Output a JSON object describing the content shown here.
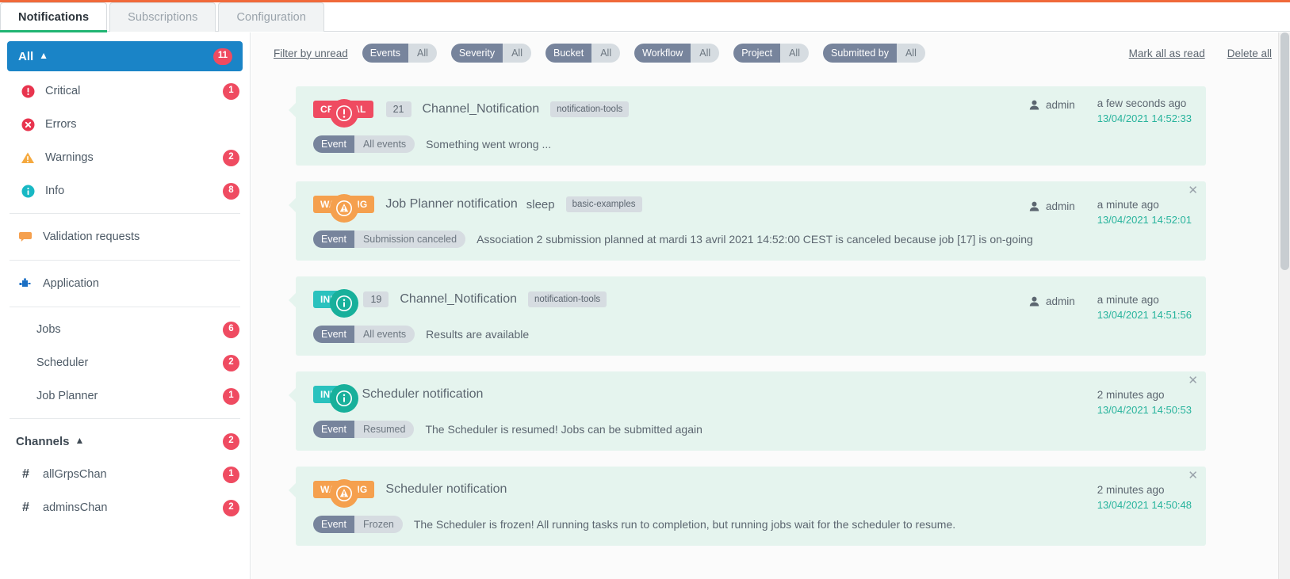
{
  "tabs": [
    {
      "label": "Notifications",
      "active": true
    },
    {
      "label": "Subscriptions",
      "active": false
    },
    {
      "label": "Configuration",
      "active": false
    }
  ],
  "sidebar": {
    "all": {
      "label": "All",
      "badge": "11"
    },
    "severities": [
      {
        "icon": "critical-icon",
        "label": "Critical",
        "badge": "1"
      },
      {
        "icon": "error-icon",
        "label": "Errors",
        "badge": ""
      },
      {
        "icon": "warning-icon",
        "label": "Warnings",
        "badge": "2"
      },
      {
        "icon": "info-icon",
        "label": "Info",
        "badge": "8"
      }
    ],
    "validation": {
      "icon": "comment-icon",
      "label": "Validation requests"
    },
    "application": {
      "icon": "puzzle-icon",
      "label": "Application"
    },
    "app_items": [
      {
        "label": "Jobs",
        "badge": "6"
      },
      {
        "label": "Scheduler",
        "badge": "2"
      },
      {
        "label": "Job Planner",
        "badge": "1"
      }
    ],
    "channels_header": {
      "label": "Channels",
      "badge": "2"
    },
    "channels": [
      {
        "hash": "#",
        "label": "allGrpsChan",
        "badge": "1"
      },
      {
        "hash": "#",
        "label": "adminsChan",
        "badge": "2"
      }
    ]
  },
  "filterbar": {
    "filter_by_unread": "Filter by unread",
    "filters": [
      {
        "key": "Events",
        "value": "All"
      },
      {
        "key": "Severity",
        "value": "All"
      },
      {
        "key": "Bucket",
        "value": "All"
      },
      {
        "key": "Workflow",
        "value": "All"
      },
      {
        "key": "Project",
        "value": "All"
      },
      {
        "key": "Submitted by",
        "value": "All"
      }
    ],
    "mark_all_as_read": "Mark all as read",
    "delete_all": "Delete all"
  },
  "notifications": [
    {
      "severity": "critical",
      "severity_label": "CRITICAL",
      "count": "21",
      "title": "Channel_Notification",
      "subtitle": "",
      "project": "notification-tools",
      "event_key": "Event",
      "event_value": "All events",
      "message": "Something went wrong ...",
      "user": "admin",
      "relative_time": "a few seconds ago",
      "absolute_time": "13/04/2021 14:52:33",
      "closable": false
    },
    {
      "severity": "warning",
      "severity_label": "WARNING",
      "count": "",
      "title": "Job Planner notification",
      "subtitle": "sleep",
      "project": "basic-examples",
      "event_key": "Event",
      "event_value": "Submission canceled",
      "message": "Association 2 submission planned at mardi 13 avril 2021 14:52:00 CEST is canceled because job [17] is on-going",
      "user": "admin",
      "relative_time": "a minute ago",
      "absolute_time": "13/04/2021 14:52:01",
      "closable": true
    },
    {
      "severity": "info",
      "severity_label": "INFO",
      "count": "19",
      "title": "Channel_Notification",
      "subtitle": "",
      "project": "notification-tools",
      "event_key": "Event",
      "event_value": "All events",
      "message": "Results are available",
      "user": "admin",
      "relative_time": "a minute ago",
      "absolute_time": "13/04/2021 14:51:56",
      "closable": false
    },
    {
      "severity": "info",
      "severity_label": "INFO",
      "count": "",
      "title": "Scheduler notification",
      "subtitle": "",
      "project": "",
      "event_key": "Event",
      "event_value": "Resumed",
      "message": "The Scheduler is resumed! Jobs can be submitted again",
      "user": "",
      "relative_time": "2 minutes ago",
      "absolute_time": "13/04/2021 14:50:53",
      "closable": true
    },
    {
      "severity": "warning",
      "severity_label": "WARNING",
      "count": "",
      "title": "Scheduler notification",
      "subtitle": "",
      "project": "",
      "event_key": "Event",
      "event_value": "Frozen",
      "message": "The Scheduler is frozen! All running tasks run to completion, but running jobs wait for the scheduler to resume.",
      "user": "",
      "relative_time": "2 minutes ago",
      "absolute_time": "13/04/2021 14:50:48",
      "closable": true
    }
  ],
  "colors": {
    "accent_orange": "#f0693a",
    "active_tab_underline": "#21b573",
    "selected_blue": "#1a84c7",
    "badge_red": "#ef4b61",
    "warning_orange": "#f5a04e",
    "info_teal": "#2ac2be",
    "card_bg": "#e5f4ee",
    "timestamp_green": "#27b39c",
    "pill_key": "#77849c",
    "pill_value": "#d6dce1"
  }
}
